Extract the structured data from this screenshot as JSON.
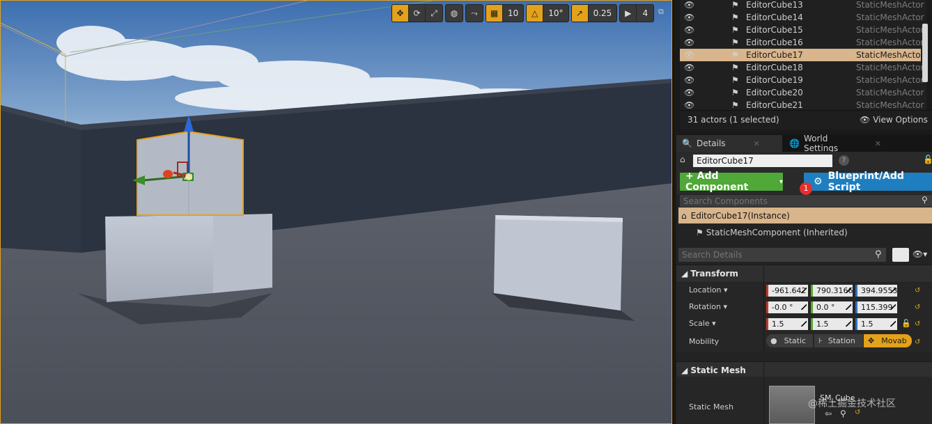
{
  "viewport": {
    "toolbar": {
      "grid_snap_value": "10",
      "rotation_snap_value": "10°",
      "scale_snap_value": "0.25",
      "camera_speed_value": "4"
    }
  },
  "outliner": {
    "rows": [
      {
        "name": "EditorCube13",
        "type": "StaticMeshActor",
        "selected": false
      },
      {
        "name": "EditorCube14",
        "type": "StaticMeshActor",
        "selected": false
      },
      {
        "name": "EditorCube15",
        "type": "StaticMeshActor",
        "selected": false
      },
      {
        "name": "EditorCube16",
        "type": "StaticMeshActor",
        "selected": false
      },
      {
        "name": "EditorCube17",
        "type": "StaticMeshActor",
        "selected": true
      },
      {
        "name": "EditorCube18",
        "type": "StaticMeshActor",
        "selected": false
      },
      {
        "name": "EditorCube19",
        "type": "StaticMeshActor",
        "selected": false
      },
      {
        "name": "EditorCube20",
        "type": "StaticMeshActor",
        "selected": false
      },
      {
        "name": "EditorCube21",
        "type": "StaticMeshActor",
        "selected": false
      }
    ],
    "actor_count": "31 actors (1 selected)",
    "view_options": "View Options"
  },
  "details": {
    "tabs": [
      {
        "label": "Details"
      },
      {
        "label": "World Settings"
      }
    ],
    "actor_name": "EditorCube17",
    "add_component": "+ Add Component",
    "blueprint_button": "Blueprint/Add Script",
    "notification_count": "1",
    "search_components_placeholder": "Search Components",
    "component_instance": "EditorCube17(Instance)",
    "component_inherited": "StaticMeshComponent (Inherited)",
    "search_details_placeholder": "Search Details",
    "transform": {
      "label": "Transform",
      "location_label": "Location",
      "location": [
        "-961.642",
        "790.3166",
        "394.9553"
      ],
      "rotation_label": "Rotation",
      "rotation": [
        "-0.0 °",
        "0.0 °",
        "115.399"
      ],
      "scale_label": "Scale",
      "scale": [
        "1.5",
        "1.5",
        "1.5"
      ],
      "mobility_label": "Mobility",
      "mobility_options": [
        "Static",
        "Station",
        "Movab"
      ]
    },
    "static_mesh": {
      "category_label": "Static Mesh",
      "property_label": "Static Mesh",
      "asset_name": "SM_Cube"
    },
    "watermark": "@稀土掘金技术社区"
  },
  "colors": {
    "selection": "#d8b58c",
    "accent": "#e3a21a",
    "add_component": "#4fa838",
    "blueprint": "#1f7ebf"
  }
}
